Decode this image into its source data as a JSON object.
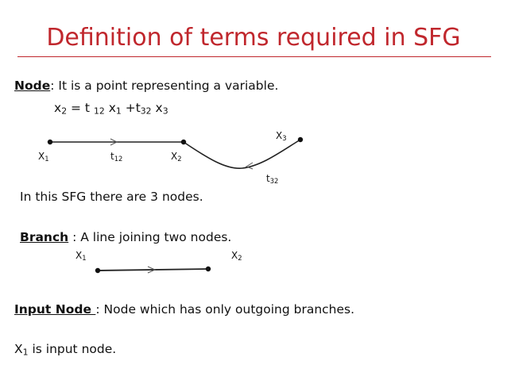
{
  "title": "Definition of terms required in SFG",
  "node": {
    "term": "Node",
    "definition": ": It is a point representing a variable.",
    "equation": {
      "lhs_var": "x",
      "lhs_sub": "2",
      "eq": " = t ",
      "t1_sub": "12",
      "x1_var": " x",
      "x1_sub": "1",
      "plus": " +t",
      "t2_sub": "32",
      "x3_var": " x",
      "x3_sub": "3"
    },
    "diagram": {
      "x1_label": "X",
      "x1_sub": "1",
      "t12_label": "t",
      "t12_sub": "12",
      "x2_label": "X",
      "x2_sub": "2",
      "x3_label": "X",
      "x3_sub": "3",
      "t32_label": "t",
      "t32_sub": "32"
    },
    "note": "In this SFG there are 3 nodes."
  },
  "branch": {
    "term": "Branch",
    "definition": " : A line joining two nodes.",
    "diagram": {
      "x1_label": "X",
      "x1_sub": "1",
      "x2_label": "X",
      "x2_sub": "2"
    }
  },
  "input_node": {
    "term": "Input Node ",
    "definition": ": Node which has only outgoing branches.",
    "example_var": "X",
    "example_sub": "1",
    "example_text": " is input node."
  }
}
